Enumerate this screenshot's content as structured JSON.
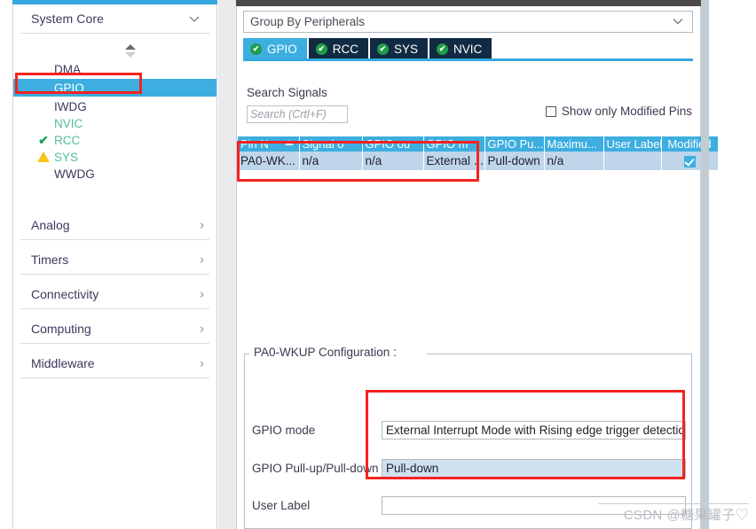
{
  "sidebar": {
    "category_header": {
      "label": "System Core",
      "icon": "chevron-down-icon"
    },
    "tree_items": [
      {
        "label": "DMA",
        "icon": "none",
        "state": "normal",
        "selected": false
      },
      {
        "label": "GPIO",
        "icon": "none",
        "state": "normal",
        "selected": true
      },
      {
        "label": "IWDG",
        "icon": "none",
        "state": "normal",
        "selected": false
      },
      {
        "label": "NVIC",
        "icon": "none",
        "state": "green",
        "selected": false
      },
      {
        "label": "RCC",
        "icon": "check-icon",
        "state": "green",
        "selected": false
      },
      {
        "label": "SYS",
        "icon": "warning-icon",
        "state": "green",
        "selected": false
      },
      {
        "label": "WWDG",
        "icon": "none",
        "state": "normal",
        "selected": false
      }
    ],
    "categories": [
      {
        "label": "Analog",
        "icon": "chevron-right-icon"
      },
      {
        "label": "Timers",
        "icon": "chevron-right-icon"
      },
      {
        "label": "Connectivity",
        "icon": "chevron-right-icon"
      },
      {
        "label": "Computing",
        "icon": "chevron-right-icon"
      },
      {
        "label": "Middleware",
        "icon": "chevron-right-icon"
      }
    ]
  },
  "main": {
    "group_select": {
      "value": "Group By Peripherals",
      "icon": "chevron-down-icon"
    },
    "tabs": [
      {
        "label": "GPIO",
        "icon": "check-circle-icon",
        "active": true
      },
      {
        "label": "RCC",
        "icon": "check-circle-icon",
        "active": false
      },
      {
        "label": "SYS",
        "icon": "check-circle-icon",
        "active": false
      },
      {
        "label": "NVIC",
        "icon": "check-circle-icon",
        "active": false
      }
    ],
    "search": {
      "label": "Search Signals",
      "placeholder": "Search (Crtl+F)",
      "value": ""
    },
    "modified_filter": {
      "label": "Show only Modified Pins",
      "checked": false
    },
    "table": {
      "columns": [
        "Pin N",
        "Signal o",
        "GPIO ou",
        "GPIO m",
        "GPIO Pu...",
        "Maximu...",
        "User Label",
        "Modified"
      ],
      "sorted_column": "Pin N",
      "sort_direction": "ascending",
      "rows": [
        {
          "pin_name": "PA0-WK...",
          "signal_on_pin": "n/a",
          "gpio_output_level": "n/a",
          "gpio_mode": "External ...",
          "gpio_pull": "Pull-down",
          "maximum_speed": "n/a",
          "user_label": "",
          "modified": true
        }
      ]
    },
    "config": {
      "legend": "PA0-WKUP Configuration :",
      "fields": [
        {
          "label": "GPIO mode",
          "value": "External Interrupt Mode with Rising edge trigger detection",
          "selected": false
        },
        {
          "label": "GPIO Pull-up/Pull-down",
          "value": "Pull-down",
          "selected": true
        },
        {
          "label": "User Label",
          "value": "",
          "selected": false
        }
      ]
    }
  },
  "watermark": {
    "text": "CSDN @糖果罐子♡"
  },
  "colors": {
    "accent_blue": "#3daee0",
    "tab_dark": "#102b42",
    "annotation_red": "#f42222",
    "green_text": "#4fbf9f",
    "warning_yellow": "#f5c518",
    "row_blue": "#bfd6ea",
    "selected_field": "#cfe0ef"
  }
}
